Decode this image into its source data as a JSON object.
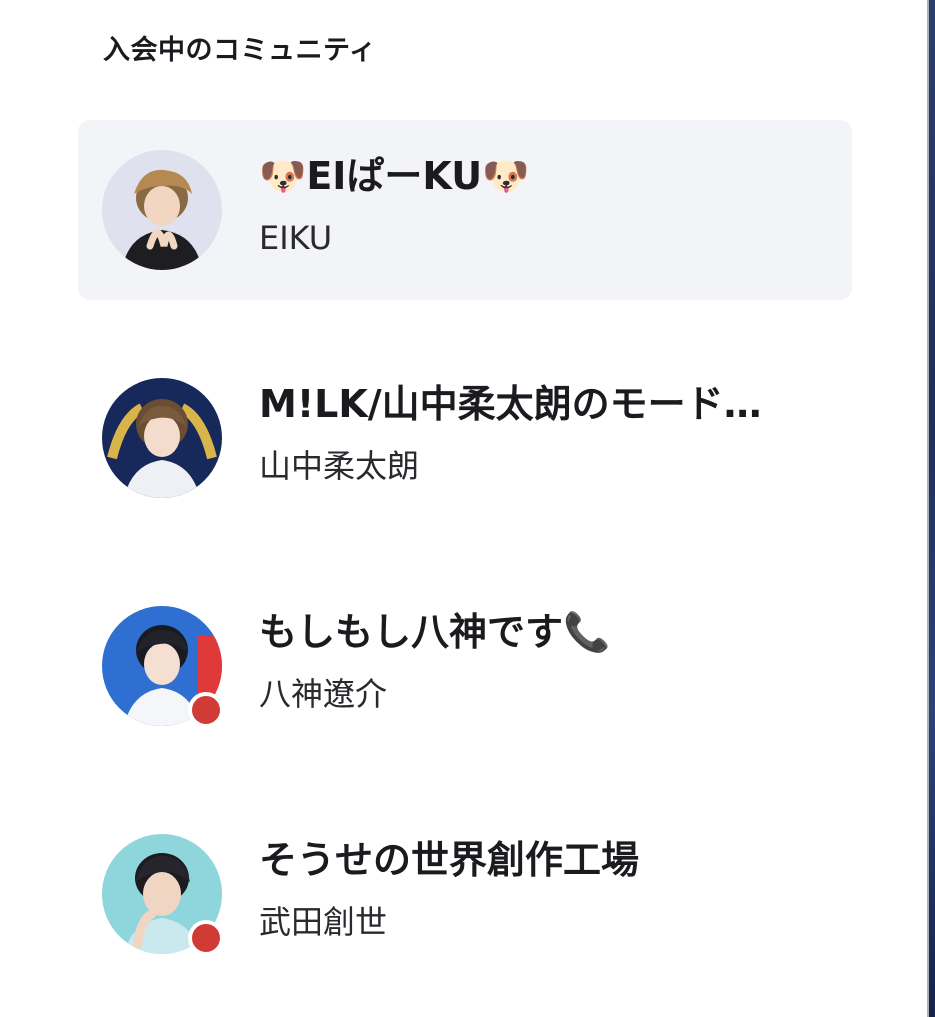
{
  "section": {
    "title": "入会中のコミュニティ"
  },
  "communities": [
    {
      "title": "🐶EIぱーKU🐶",
      "owner": "EIKU",
      "selected": true,
      "live": false,
      "avatar_icon": "avatar-eiku"
    },
    {
      "title": "M!LK/山中柔太朗のモード…",
      "owner": "山中柔太朗",
      "selected": false,
      "live": false,
      "avatar_icon": "avatar-yamanaka"
    },
    {
      "title": "もしもし八神です📞",
      "owner": "八神遼介",
      "selected": false,
      "live": true,
      "avatar_icon": "avatar-yagami"
    },
    {
      "title": "そうせの世界創作工場",
      "owner": "武田創世",
      "selected": false,
      "live": true,
      "avatar_icon": "avatar-takeda"
    }
  ],
  "colors": {
    "selected_bg": "#f3f4f7",
    "live_dot": "#d13b35",
    "text": "#1b1b1f"
  }
}
